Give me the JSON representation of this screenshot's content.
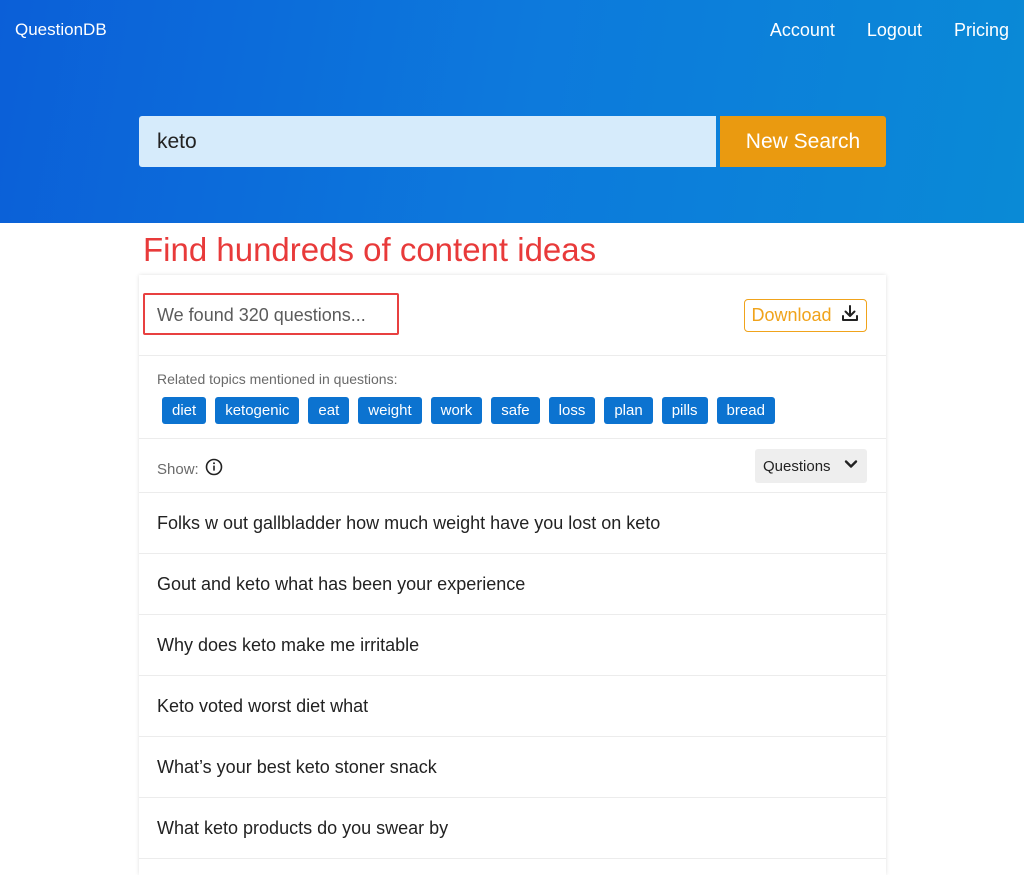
{
  "header": {
    "brand": "QuestionDB",
    "nav": [
      "Account",
      "Logout",
      "Pricing"
    ]
  },
  "search": {
    "value": "keto",
    "button_label": "New Search"
  },
  "annotation": "Find hundreds of content ideas",
  "results": {
    "found_text": "We found 320 questions...",
    "download_label": "Download",
    "related_label": "Related topics mentioned in questions:",
    "topics": [
      "diet",
      "ketogenic",
      "eat",
      "weight",
      "work",
      "safe",
      "loss",
      "plan",
      "pills",
      "bread"
    ],
    "show_label": "Show:",
    "show_value": "Questions",
    "questions": [
      "Folks w out gallbladder how much weight have you lost on keto",
      "Gout and keto what has been your experience",
      "Why does keto make me irritable",
      "Keto voted worst diet what",
      "What’s your best keto stoner snack",
      "What keto products do you swear by"
    ]
  },
  "colors": {
    "accent_blue": "#0c73d0",
    "search_button": "#ea9a10",
    "annotation_red": "#e83a3a"
  }
}
